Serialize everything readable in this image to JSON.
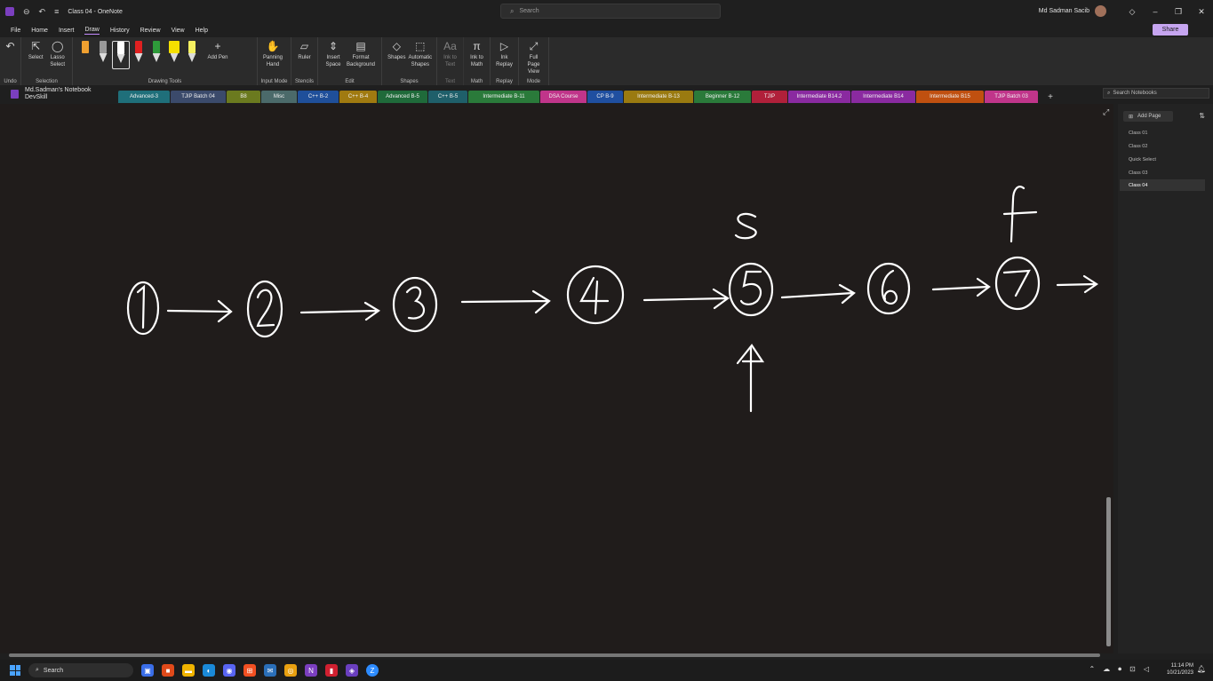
{
  "window": {
    "title": "Class 04 - OneNote",
    "search_placeholder": "Search",
    "user_name": "Md Sadman Sacib",
    "share_label": "Share"
  },
  "menu": [
    "File",
    "Home",
    "Insert",
    "Draw",
    "History",
    "Review",
    "View",
    "Help"
  ],
  "menu_active": "Draw",
  "ribbon": {
    "undo_group": "Undo",
    "selection": {
      "select": "Select",
      "lasso": "Lasso Select",
      "label": "Selection"
    },
    "drawing_tools_label": "Drawing Tools",
    "add_pen": "Add Pen",
    "input_mode": {
      "panning": "Panning Hand",
      "label": "Input Mode"
    },
    "stencils": {
      "ruler": "Ruler",
      "label": "Stencils"
    },
    "edit": {
      "insert_space": "Insert Space",
      "format_bg": "Format Background",
      "label": "Edit"
    },
    "shapes": {
      "shapes": "Shapes",
      "auto": "Automatic Shapes",
      "label": "Shapes"
    },
    "text": {
      "ink_to_text": "Ink to Text",
      "label": "Text"
    },
    "math": {
      "ink_to_math": "Ink to Math",
      "label": "Math"
    },
    "replay": {
      "ink_replay": "Ink Replay",
      "label": "Replay"
    },
    "mode": {
      "full_page": "Full Page View",
      "label": "Mode"
    },
    "pen_colors": [
      "#f0a030",
      "#9a9a9a",
      "#ffffff",
      "#e02020",
      "#2e9a3a",
      "#f5e000",
      "#f5f060"
    ]
  },
  "notebook": {
    "name": "Md.Sadman's Notebook",
    "section_group": "DevSkill",
    "search_placeholder": "Search Notebooks"
  },
  "tabs": [
    {
      "label": "Advanced-3",
      "color": "#1f6f7a"
    },
    {
      "label": "TJIP Batch 04",
      "color": "#3b4a6b"
    },
    {
      "label": "B8",
      "color": "#6b7a1f"
    },
    {
      "label": "Misc",
      "color": "#4b6a6a"
    },
    {
      "label": "C++ B-2",
      "color": "#1f4f9a"
    },
    {
      "label": "C++ B-4",
      "color": "#a07a10"
    },
    {
      "label": "Advanced B-5",
      "color": "#1f6a3a"
    },
    {
      "label": "C++ B-5",
      "color": "#1f5f6a"
    },
    {
      "label": "Intermediate B-11",
      "color": "#2a7a3a"
    },
    {
      "label": "DSA Course",
      "color": "#c0358a"
    },
    {
      "label": "CP B-9",
      "color": "#1f4fa0"
    },
    {
      "label": "Intermediate B-13",
      "color": "#9a7a10"
    },
    {
      "label": "Beginner B-12",
      "color": "#2a7a3a"
    },
    {
      "label": "TJIP",
      "color": "#b0203a"
    },
    {
      "label": "Intermediate B14.2",
      "color": "#8a2aa0"
    },
    {
      "label": "Intermediate B14",
      "color": "#8a2aa0"
    },
    {
      "label": "Intermediate B15",
      "color": "#c05010"
    },
    {
      "label": "TJIP Batch 03",
      "color": "#c0358a"
    }
  ],
  "pages": {
    "add_page": "Add Page",
    "items": [
      "Class 01",
      "Class 02",
      "Quick Select",
      "Class 03",
      "Class 04"
    ],
    "active": "Class 04"
  },
  "ink": {
    "node_labels": [
      "1",
      "2",
      "3",
      "4",
      "5",
      "6",
      "7"
    ],
    "label_s": "S",
    "label_f": "f"
  },
  "taskbar": {
    "search": "Search",
    "time": "11:14 PM",
    "date": "10/21/2023"
  }
}
